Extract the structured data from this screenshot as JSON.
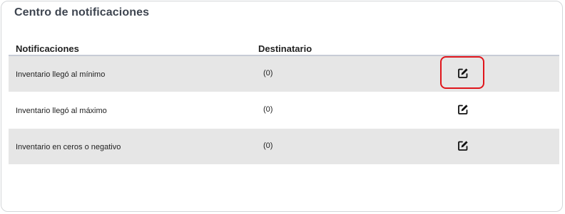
{
  "panel": {
    "title": "Centro de notificaciones"
  },
  "table": {
    "headers": {
      "notifications": "Notificaciones",
      "recipient": "Destinatario"
    },
    "rows": [
      {
        "name": "Inventario llegó al mínimo",
        "count": "(0)",
        "action_icon": "edit-icon",
        "highlighted": true
      },
      {
        "name": "Inventario llegó al máximo",
        "count": "(0)",
        "action_icon": "edit-icon",
        "highlighted": false
      },
      {
        "name": "Inventario en ceros o negativo",
        "count": "(0)",
        "action_icon": "edit-icon",
        "highlighted": false
      }
    ]
  },
  "colors": {
    "title": "#3e4550",
    "row_shade": "#e6e6e6",
    "header_rule": "#c7ccd6",
    "highlight": "#e0151b"
  }
}
